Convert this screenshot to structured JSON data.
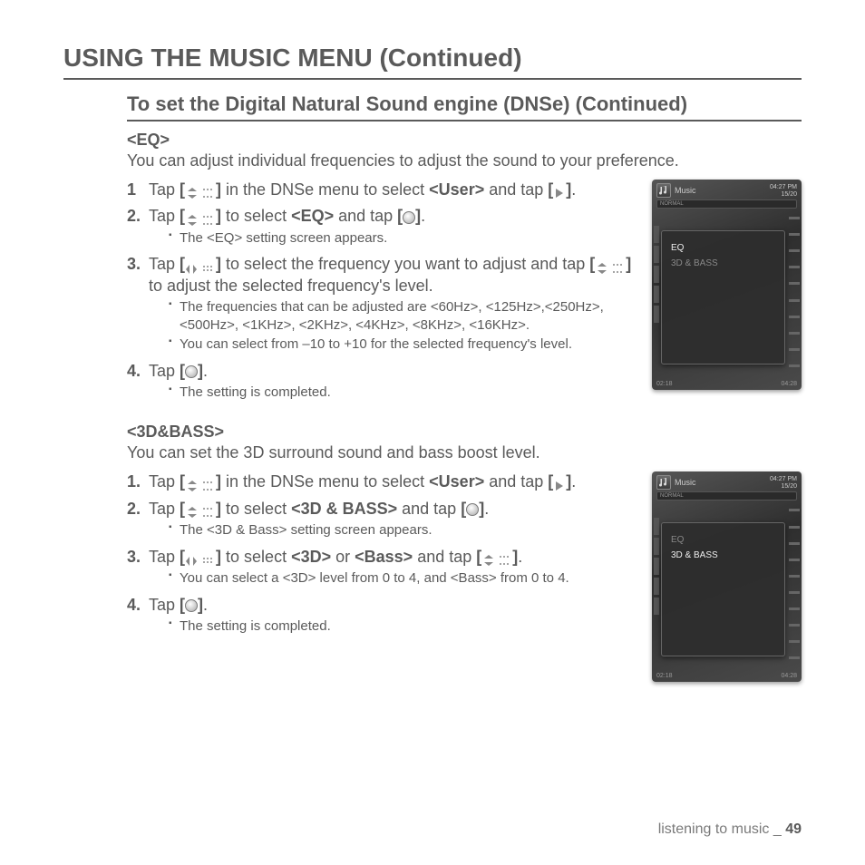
{
  "page": {
    "h1": "USING THE MUSIC MENU (Continued)",
    "h2": "To set the Digital Natural Sound engine (DNSe) (Continued)"
  },
  "eq": {
    "label": "<EQ>",
    "intro": "You can adjust individual frequencies to adjust the sound to your preference.",
    "steps": {
      "s1a": "Tap ",
      "s1b": " in the DNSe menu to select ",
      "s1c": "<User>",
      "s1d": " and tap ",
      "s1e": ".",
      "s2a": "Tap ",
      "s2b": " to select ",
      "s2c": "<EQ>",
      "s2d": " and tap ",
      "s2e": ".",
      "s2sub": "The <EQ> setting screen appears.",
      "s3a": "Tap ",
      "s3b": " to select the frequency you want to adjust and tap ",
      "s3c": " to adjust the selected frequency's level.",
      "s3sub1": "The frequencies that can be adjusted are <60Hz>, <125Hz>,<250Hz>, <500Hz>, <1KHz>, <2KHz>, <4KHz>, <8KHz>, <16KHz>.",
      "s3sub2": "You can select from –10 to +10 for the selected frequency's level.",
      "s4a": "Tap ",
      "s4b": ".",
      "s4sub": "The setting is completed."
    }
  },
  "bass": {
    "label": "<3D&BASS>",
    "intro": "You can set the 3D surround sound and bass boost level.",
    "steps": {
      "s1a": "Tap ",
      "s1b": " in the DNSe menu to select ",
      "s1c": "<User>",
      "s1d": " and tap ",
      "s1e": ".",
      "s2a": "Tap ",
      "s2b": " to select ",
      "s2c": "<3D & BASS>",
      "s2d": " and tap ",
      "s2e": ".",
      "s2sub": "The <3D & Bass> setting screen appears.",
      "s3a": "Tap ",
      "s3b": " to select ",
      "s3c": "<3D>",
      "s3d": " or ",
      "s3e": "<Bass>",
      "s3f": " and tap ",
      "s3g": ".",
      "s3sub": "You can select a <3D> level from 0 to 4, and <Bass> from 0 to 4.",
      "s4a": "Tap ",
      "s4b": ".",
      "s4sub": "The setting is completed."
    }
  },
  "device": {
    "title": "Music",
    "time": "04:27 PM",
    "count": "15/20",
    "opt1": "EQ",
    "opt2": "3D & BASS",
    "t_left": "02:18",
    "t_right": "04:28",
    "normal": "NORMAL"
  },
  "footer": {
    "section": "listening to music",
    "sep": " _ ",
    "page": "49"
  }
}
